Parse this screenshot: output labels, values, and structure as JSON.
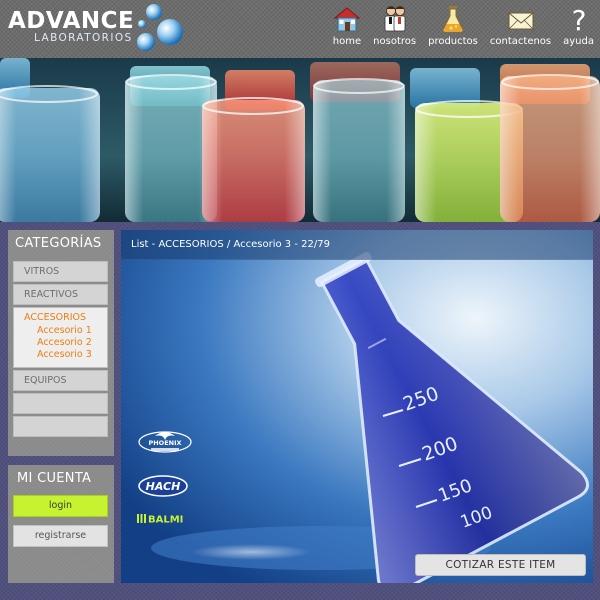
{
  "header": {
    "logo": {
      "main": "ADVANCE",
      "sub": "LABORATORIOS"
    },
    "nav": [
      {
        "label": "home",
        "icon": "house-icon"
      },
      {
        "label": "nosotros",
        "icon": "scientists-icon"
      },
      {
        "label": "productos",
        "icon": "flask-icon"
      },
      {
        "label": "contactenos",
        "icon": "envelope-icon"
      },
      {
        "label": "ayuda",
        "icon": "question-icon"
      }
    ]
  },
  "sidebar": {
    "categories": {
      "title": "CATEGORÍAS",
      "items": [
        {
          "label": "VITROS"
        },
        {
          "label": "REACTIVOS"
        },
        {
          "label": "ACCESORIOS",
          "active": true,
          "children": [
            "Accesorio 1",
            "Accesorio 2",
            "Accesorio 3"
          ]
        },
        {
          "label": "EQUIPOS"
        },
        {
          "label": ""
        },
        {
          "label": ""
        }
      ]
    },
    "account": {
      "title": "MI CUENTA",
      "login_label": "login",
      "register_label": "registrarse"
    }
  },
  "main": {
    "breadcrumb": "List - ACCESORIOS / Accesorio 3 - 22/79",
    "brands": [
      "PHOENIX",
      "HACH",
      "BALMI"
    ],
    "flask_marks": [
      "250",
      "200",
      "150",
      "100"
    ],
    "quote_label": "COTIZAR ESTE ITEM"
  },
  "colors": {
    "accent_orange": "#ef7d10",
    "login_green": "#c6f230",
    "page_bg": "#50507e",
    "header_bg": "#6d6d6d"
  }
}
